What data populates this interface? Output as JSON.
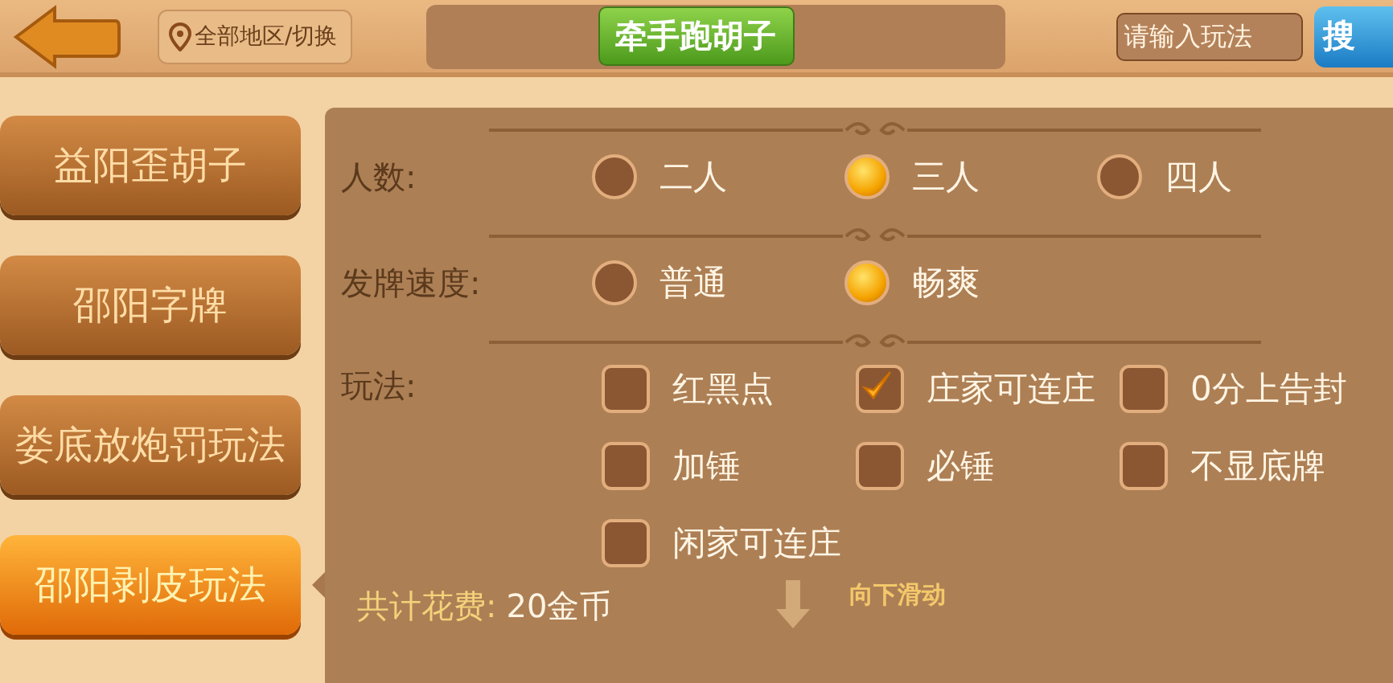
{
  "top_bar": {
    "region_button": "全部地区/切换",
    "title": "牵手跑胡子",
    "search": {
      "placeholder": "请输入玩法"
    },
    "search_button": "搜"
  },
  "sidebar": {
    "items": [
      {
        "label": "益阳歪胡子",
        "selected": false
      },
      {
        "label": "邵阳字牌",
        "selected": false
      },
      {
        "label": "娄底放炮罚玩法",
        "selected": false
      },
      {
        "label": "邵阳剥皮玩法",
        "selected": true
      }
    ]
  },
  "settings": {
    "groups": [
      {
        "kind": "radio",
        "label": "人数:",
        "options": [
          {
            "label": "二人",
            "selected": false
          },
          {
            "label": "三人",
            "selected": true
          },
          {
            "label": "四人",
            "selected": false
          }
        ]
      },
      {
        "kind": "radio",
        "label": "发牌速度:",
        "options": [
          {
            "label": "普通",
            "selected": false
          },
          {
            "label": "畅爽",
            "selected": true
          }
        ]
      },
      {
        "kind": "checkbox",
        "label": "玩法:",
        "options": [
          {
            "label": "红黑点",
            "checked": false
          },
          {
            "label": "庄家可连庄",
            "checked": true
          },
          {
            "label": "0分上告封",
            "checked": false
          },
          {
            "label": "加锤",
            "checked": false
          },
          {
            "label": "必锤",
            "checked": false
          },
          {
            "label": "不显底牌",
            "checked": false
          },
          {
            "label": "闲家可连庄",
            "checked": false
          }
        ]
      }
    ]
  },
  "footer": {
    "cost_label": "共计花费:",
    "cost": "20金币",
    "scroll_hint": "向下滑动"
  }
}
